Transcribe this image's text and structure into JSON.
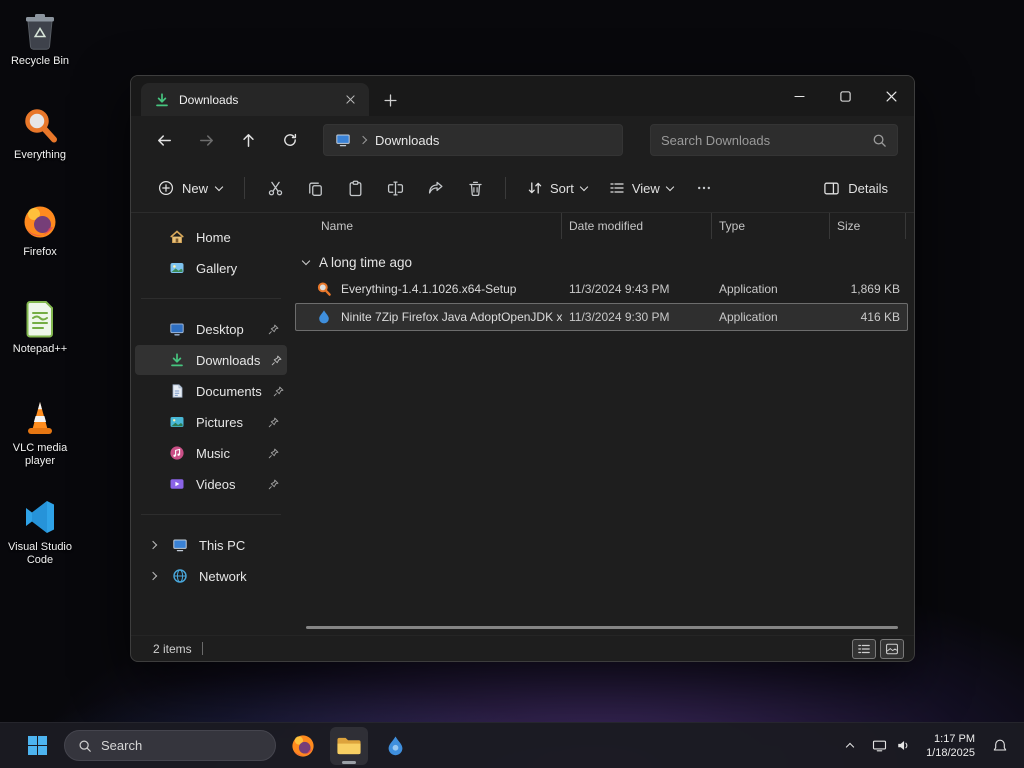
{
  "colors": {
    "accent_blue": "#4cc2ff",
    "downloads_green": "#46c57f",
    "folder_yellow": "#f8cf63",
    "selection_gray": "rgba(255,255,255,0.08)"
  },
  "desktop": {
    "icons": [
      {
        "label": "Recycle Bin",
        "icon": "recycle-bin-icon"
      },
      {
        "label": "Everything",
        "icon": "everything-icon"
      },
      {
        "label": "Firefox",
        "icon": "firefox-icon"
      },
      {
        "label": "Notepad++",
        "icon": "notepadpp-icon"
      },
      {
        "label": "VLC media player",
        "icon": "vlc-icon"
      },
      {
        "label": "Visual Studio Code",
        "icon": "vscode-icon"
      }
    ]
  },
  "explorer": {
    "tab": {
      "title": "Downloads",
      "icon": "download-icon"
    },
    "nav": {
      "location": "Downloads",
      "location_icon": "this-pc-icon",
      "search_placeholder": "Search Downloads"
    },
    "toolbar": {
      "new_label": "New",
      "icon_buttons": [
        "cut-icon",
        "copy-icon",
        "paste-icon",
        "rename-icon",
        "share-icon",
        "delete-icon"
      ],
      "sort_label": "Sort",
      "view_label": "View",
      "details_label": "Details"
    },
    "sidebar": {
      "top": [
        {
          "label": "Home",
          "icon": "home-icon"
        },
        {
          "label": "Gallery",
          "icon": "gallery-icon"
        }
      ],
      "pinned": [
        {
          "label": "Desktop",
          "icon": "desktop-monitor-icon",
          "pinned": true
        },
        {
          "label": "Downloads",
          "icon": "download-icon",
          "pinned": true,
          "selected": true
        },
        {
          "label": "Documents",
          "icon": "document-icon",
          "pinned": true
        },
        {
          "label": "Pictures",
          "icon": "pictures-icon",
          "pinned": true
        },
        {
          "label": "Music",
          "icon": "music-icon",
          "pinned": true
        },
        {
          "label": "Videos",
          "icon": "videos-icon",
          "pinned": true
        }
      ],
      "tree": [
        {
          "label": "This PC",
          "icon": "this-pc-icon"
        },
        {
          "label": "Network",
          "icon": "network-icon"
        }
      ]
    },
    "list": {
      "columns": [
        "Name",
        "Date modified",
        "Type",
        "Size"
      ],
      "group_label": "A long time ago",
      "files": [
        {
          "name": "Everything-1.4.1.1026.x64-Setup",
          "date_modified": "11/3/2024 9:43 PM",
          "type": "Application",
          "size": "1,869 KB",
          "icon": "everything-icon",
          "selected": false
        },
        {
          "name": "Ninite 7Zip Firefox Java AdoptOpenJDK x...",
          "date_modified": "11/3/2024 9:30 PM",
          "type": "Application",
          "size": "416 KB",
          "icon": "ninite-icon",
          "selected": true
        }
      ]
    },
    "status_bar": {
      "items_count": "2 items"
    }
  },
  "taskbar": {
    "search_label": "Search",
    "apps": [
      "firefox-icon",
      "file-explorer-icon",
      "ninite-icon"
    ],
    "tray": {
      "time": "1:17 PM",
      "date": "1/18/2025"
    }
  }
}
